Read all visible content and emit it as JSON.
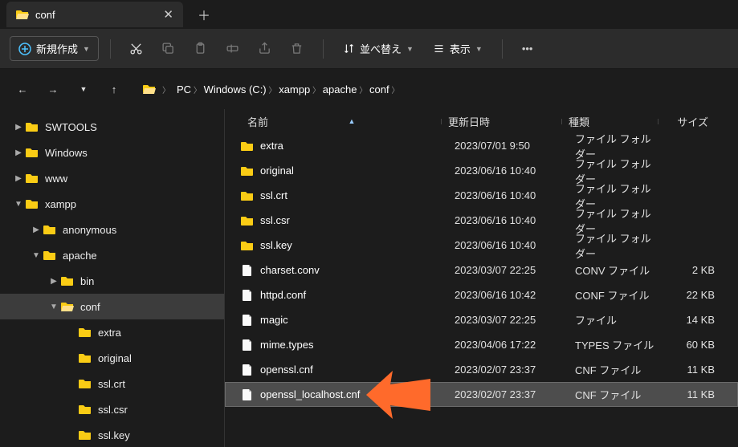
{
  "tab": {
    "title": "conf"
  },
  "toolbar": {
    "new_label": "新規作成",
    "sort_label": "並べ替え",
    "view_label": "表示"
  },
  "breadcrumb": [
    "PC",
    "Windows (C:)",
    "xampp",
    "apache",
    "conf"
  ],
  "columns": {
    "name": "名前",
    "date": "更新日時",
    "type": "種類",
    "size": "サイズ"
  },
  "tree": [
    {
      "depth": 0,
      "chev": "right",
      "icon": "folder",
      "label": "SWTOOLS"
    },
    {
      "depth": 0,
      "chev": "right",
      "icon": "folder",
      "label": "Windows"
    },
    {
      "depth": 0,
      "chev": "right",
      "icon": "folder",
      "label": "www"
    },
    {
      "depth": 0,
      "chev": "down",
      "icon": "folder",
      "label": "xampp"
    },
    {
      "depth": 1,
      "chev": "right",
      "icon": "folder",
      "label": "anonymous"
    },
    {
      "depth": 1,
      "chev": "down",
      "icon": "folder",
      "label": "apache"
    },
    {
      "depth": 2,
      "chev": "right",
      "icon": "folder",
      "label": "bin"
    },
    {
      "depth": 2,
      "chev": "down",
      "icon": "folder-open",
      "label": "conf",
      "selected": true
    },
    {
      "depth": 3,
      "chev": "",
      "icon": "folder",
      "label": "extra"
    },
    {
      "depth": 3,
      "chev": "",
      "icon": "folder",
      "label": "original"
    },
    {
      "depth": 3,
      "chev": "",
      "icon": "folder",
      "label": "ssl.crt"
    },
    {
      "depth": 3,
      "chev": "",
      "icon": "folder",
      "label": "ssl.csr"
    },
    {
      "depth": 3,
      "chev": "",
      "icon": "folder",
      "label": "ssl.key"
    }
  ],
  "files": [
    {
      "icon": "folder",
      "name": "extra",
      "date": "2023/07/01 9:50",
      "type": "ファイル フォルダー",
      "size": ""
    },
    {
      "icon": "folder",
      "name": "original",
      "date": "2023/06/16 10:40",
      "type": "ファイル フォルダー",
      "size": ""
    },
    {
      "icon": "folder",
      "name": "ssl.crt",
      "date": "2023/06/16 10:40",
      "type": "ファイル フォルダー",
      "size": ""
    },
    {
      "icon": "folder",
      "name": "ssl.csr",
      "date": "2023/06/16 10:40",
      "type": "ファイル フォルダー",
      "size": ""
    },
    {
      "icon": "folder",
      "name": "ssl.key",
      "date": "2023/06/16 10:40",
      "type": "ファイル フォルダー",
      "size": ""
    },
    {
      "icon": "file",
      "name": "charset.conv",
      "date": "2023/03/07 22:25",
      "type": "CONV ファイル",
      "size": "2 KB"
    },
    {
      "icon": "file",
      "name": "httpd.conf",
      "date": "2023/06/16 10:42",
      "type": "CONF ファイル",
      "size": "22 KB"
    },
    {
      "icon": "file",
      "name": "magic",
      "date": "2023/03/07 22:25",
      "type": "ファイル",
      "size": "14 KB"
    },
    {
      "icon": "file",
      "name": "mime.types",
      "date": "2023/04/06 17:22",
      "type": "TYPES ファイル",
      "size": "60 KB"
    },
    {
      "icon": "file",
      "name": "openssl.cnf",
      "date": "2023/02/07 23:37",
      "type": "CNF ファイル",
      "size": "11 KB"
    },
    {
      "icon": "file",
      "name": "openssl_localhost.cnf",
      "date": "2023/02/07 23:37",
      "type": "CNF ファイル",
      "size": "11 KB",
      "selected": true
    }
  ],
  "annotation": {
    "color": "#ff6a2b"
  }
}
